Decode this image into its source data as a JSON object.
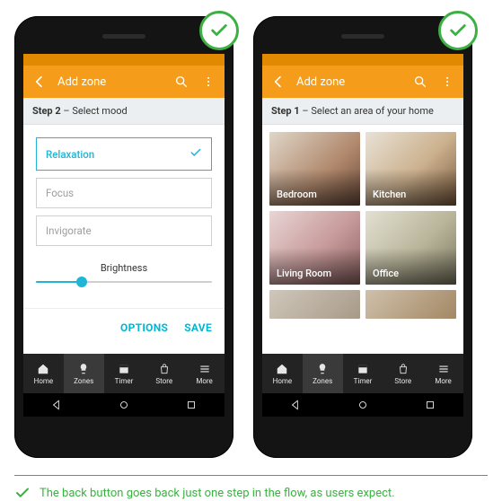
{
  "colors": {
    "accent": "#f59c1a",
    "accent_dark": "#e18900",
    "teal": "#1fb6d6",
    "cyan": "#00b8d4",
    "green": "#3cb043"
  },
  "phones": [
    {
      "app_bar": {
        "title": "Add zone"
      },
      "step": {
        "number": "Step 2",
        "label": " – Select mood"
      },
      "moods": [
        {
          "label": "Relaxation",
          "selected": true
        },
        {
          "label": "Focus",
          "selected": false
        },
        {
          "label": "Invigorate",
          "selected": false
        }
      ],
      "brightness": {
        "label": "Brightness",
        "value_pct": 26
      },
      "actions": {
        "options": "OPTIONS",
        "save": "SAVE"
      },
      "tabs": [
        {
          "label": "Home"
        },
        {
          "label": "Zones",
          "active": true
        },
        {
          "label": "Timer"
        },
        {
          "label": "Store"
        },
        {
          "label": "More"
        }
      ]
    },
    {
      "app_bar": {
        "title": "Add zone"
      },
      "step": {
        "number": "Step 1",
        "label": " – Select an area of your home"
      },
      "rooms": [
        {
          "label": "Bedroom"
        },
        {
          "label": "Kitchen"
        },
        {
          "label": "Living Room"
        },
        {
          "label": "Office"
        }
      ],
      "tabs": [
        {
          "label": "Home"
        },
        {
          "label": "Zones",
          "active": true
        },
        {
          "label": "Timer"
        },
        {
          "label": "Store"
        },
        {
          "label": "More"
        }
      ]
    }
  ],
  "caption": "The back button goes back just one step in the flow, as users expect."
}
